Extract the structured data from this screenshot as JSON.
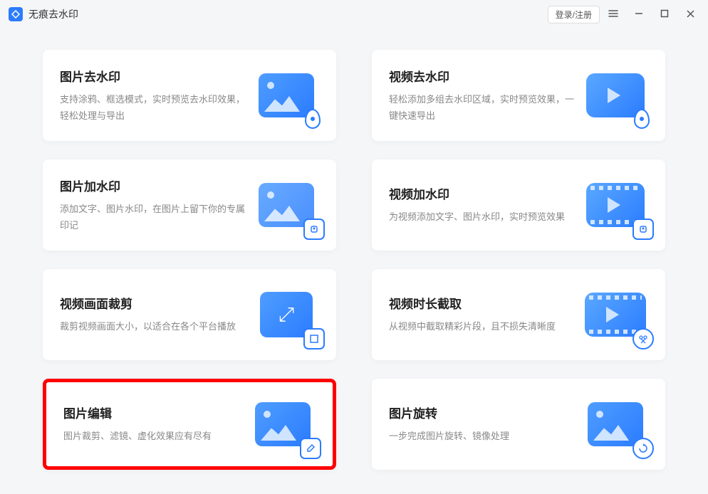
{
  "app": {
    "title": "无痕去水印"
  },
  "header": {
    "login": "登录/注册"
  },
  "cards": [
    {
      "title": "图片去水印",
      "desc": "支持涂鸦、框选模式，实时预览去水印效果，轻松处理与导出",
      "icon": "image-remove-watermark"
    },
    {
      "title": "视频去水印",
      "desc": "轻松添加多组去水印区域，实时预览效果，一键快速导出",
      "icon": "video-remove-watermark"
    },
    {
      "title": "图片加水印",
      "desc": "添加文字、图片水印，在图片上留下你的专属印记",
      "icon": "image-add-watermark"
    },
    {
      "title": "视频加水印",
      "desc": "为视频添加文字、图片水印，实时预览效果",
      "icon": "video-add-watermark"
    },
    {
      "title": "视频画面裁剪",
      "desc": "裁剪视频画面大小，以适合在各个平台播放",
      "icon": "video-crop"
    },
    {
      "title": "视频时长截取",
      "desc": "从视频中截取精彩片段，且不损失清晰度",
      "icon": "video-trim"
    },
    {
      "title": "图片编辑",
      "desc": "图片裁剪、滤镜、虚化效果应有尽有",
      "icon": "image-edit"
    },
    {
      "title": "图片旋转",
      "desc": "一步完成图片旋转、镜像处理",
      "icon": "image-rotate"
    }
  ],
  "highlighted_card_index": 6
}
